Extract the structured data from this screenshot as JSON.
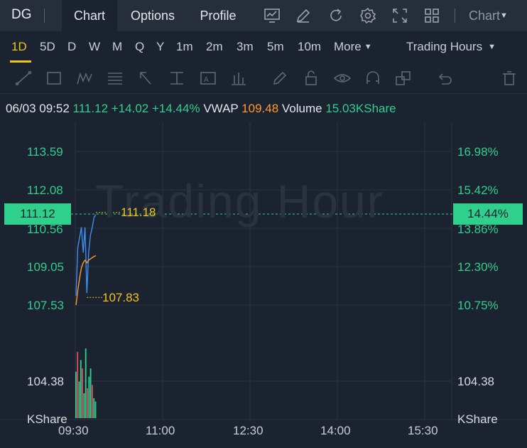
{
  "topbar": {
    "symbol": "DG",
    "tabs": [
      "Chart",
      "Options",
      "Profile"
    ],
    "chart_menu": "Chart",
    "icons": [
      "chart-board-icon",
      "pencil-icon",
      "refresh-icon",
      "settings-icon",
      "expand-icon",
      "grid-layout-icon"
    ]
  },
  "periods": {
    "items": [
      "1D",
      "5D",
      "D",
      "W",
      "M",
      "Q",
      "Y",
      "1m",
      "2m",
      "3m",
      "5m",
      "10m",
      "More"
    ],
    "active": "1D",
    "session": "Trading Hours"
  },
  "drawing_tools": [
    "line-tool-icon",
    "rectangle-tool-icon",
    "pattern-tool-icon",
    "fibonacci-tool-icon",
    "arrow-tool-icon",
    "measure-tool-icon",
    "text-tool-icon",
    "bar-pattern-tool-icon",
    "brush-tool-icon",
    "lock-icon",
    "eye-icon",
    "magnet-icon",
    "layers-icon",
    "undo-icon",
    "trash-icon"
  ],
  "info": {
    "datetime": "06/03 09:52",
    "price": "111.12",
    "change": "+14.02",
    "change_pct": "+14.44%",
    "vwap_label": "VWAP",
    "vwap_value": "109.48",
    "volume_label": "Volume",
    "volume_value": "15.03KShare"
  },
  "chart": {
    "watermark": "Trading Hour",
    "current_price_label": "111.12",
    "current_pct_label": "14.44%",
    "high_callout": "111.18",
    "low_callout": "107.83",
    "price_labels": [
      "113.59",
      "112.08",
      "110.56",
      "109.05",
      "107.53"
    ],
    "pct_labels": [
      "16.98%",
      "15.42%",
      "13.86%",
      "12.30%",
      "10.75%"
    ],
    "volume_left_label": "104.38",
    "volume_right_label": "104.38",
    "volume_unit_left": "KShare",
    "volume_unit_right": "KShare",
    "time_labels": [
      "09:30",
      "11:00",
      "12:30",
      "14:00",
      "15:30"
    ]
  },
  "colors": {
    "up": "#2fcf8c",
    "down": "#e04b5a",
    "accent": "#f0c419",
    "vwap": "#ff9a2e",
    "price_line": "#3d8ef0"
  },
  "chart_data": {
    "type": "line",
    "x": [
      "09:30",
      "09:32",
      "09:34",
      "09:36",
      "09:38",
      "09:40",
      "09:42",
      "09:44",
      "09:46",
      "09:48",
      "09:50",
      "09:52"
    ],
    "series": [
      {
        "values": [
          107.9,
          109.8,
          110.2,
          110.6,
          109.6,
          110.6,
          108.0,
          109.6,
          110.3,
          110.6,
          111.0,
          111.1
        ]
      },
      {
        "name": "VWAP",
        "values": [
          107.53,
          108.1,
          108.6,
          109.0,
          109.2,
          109.3,
          109.2,
          109.3,
          109.35,
          109.4,
          109.45,
          109.48
        ]
      }
    ],
    "volume": [
      28,
      40,
      22,
      35,
      30,
      15,
      42,
      18,
      25,
      30,
      20,
      12,
      10
    ],
    "ylim": [
      104.38,
      114.5
    ]
  }
}
